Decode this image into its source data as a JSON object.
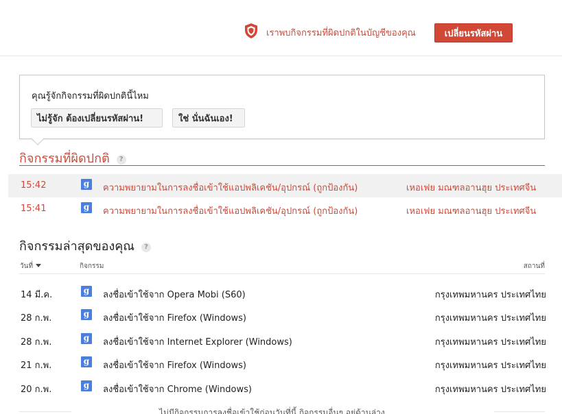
{
  "header": {
    "alert_icon": "shield-alert-icon",
    "alert_text": "เราพบกิจกรรมที่ผิดปกติในบัญชีของคุณ",
    "change_password_label": "เปลี่ยนรหัสผ่าน"
  },
  "question": {
    "title": "คุณรู้จักกิจกรรมที่ผิดปกตินี้ไหม",
    "no_label": "ไม่รู้จัก ต้องเปลี่ยนรหัสผ่าน!",
    "yes_label": "ใช่ นั่นฉันเอง!"
  },
  "suspicious": {
    "title": "กิจกรรมที่ผิดปกติ",
    "help": "?",
    "rows": [
      {
        "time": "15:42",
        "icon": "g",
        "activity": "ความพยายามในการลงชื่อเข้าใช้แอปพลิเคชัน/อุปกรณ์ (ถูกป้องกัน)",
        "location": "เหอเฟย มณฑลอานฮุย ประเทศจีน"
      },
      {
        "time": "15:41",
        "icon": "g",
        "activity": "ความพยายามในการลงชื่อเข้าใช้แอปพลิเคชัน/อุปกรณ์ (ถูกป้องกัน)",
        "location": "เหอเฟย มณฑลอานฮุย ประเทศจีน"
      }
    ]
  },
  "recent": {
    "title": "กิจกรรมล่าสุดของคุณ",
    "help": "?",
    "columns": {
      "date": "วันที่",
      "activity": "กิจกรรม",
      "location": "สถานที่"
    },
    "rows": [
      {
        "date": "14 มี.ค.",
        "icon": "g",
        "activity": "ลงชื่อเข้าใช้จาก Opera Mobi (S60)",
        "location": "กรุงเทพมหานคร ประเทศไทย"
      },
      {
        "date": "28 ก.พ.",
        "icon": "g",
        "activity": "ลงชื่อเข้าใช้จาก Firefox (Windows)",
        "location": "กรุงเทพมหานคร ประเทศไทย"
      },
      {
        "date": "28 ก.พ.",
        "icon": "g",
        "activity": "ลงชื่อเข้าใช้จาก Internet Explorer (Windows)",
        "location": "กรุงเทพมหานคร ประเทศไทย"
      },
      {
        "date": "21 ก.พ.",
        "icon": "g",
        "activity": "ลงชื่อเข้าใช้จาก Firefox (Windows)",
        "location": "กรุงเทพมหานคร ประเทศไทย"
      },
      {
        "date": "20 ก.พ.",
        "icon": "g",
        "activity": "ลงชื่อเข้าใช้จาก Chrome (Windows)",
        "location": "กรุงเทพมหานคร ประเทศไทย"
      }
    ],
    "footer_note": "ไม่มีกิจกรรมการลงชื่อเข้าใช้ก่อนวันที่นี้ กิจกรรมอื่นๆ อยู่ด้านล่าง"
  },
  "colors": {
    "alert": "#d14836",
    "google_icon": "#4a7fe0"
  }
}
